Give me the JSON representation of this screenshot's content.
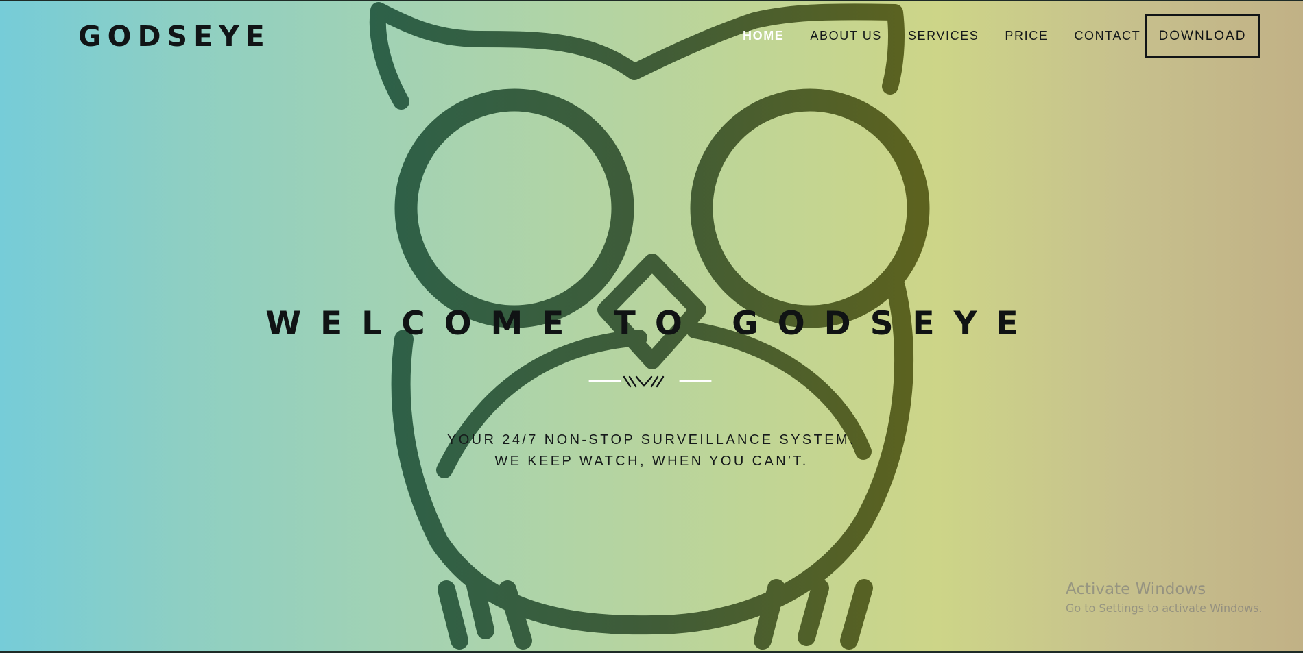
{
  "brand": {
    "logo": "GODSEYE"
  },
  "nav": {
    "items": [
      {
        "label": "HOME",
        "active": true
      },
      {
        "label": "ABOUT US",
        "active": false
      },
      {
        "label": "SERVICES",
        "active": false
      },
      {
        "label": "PRICE",
        "active": false
      },
      {
        "label": "CONTACT",
        "active": false
      }
    ],
    "download_label": "DOWNLOAD"
  },
  "hero": {
    "title": "WELCOME TO GODSEYE",
    "tagline_line1": "YOUR 24/7 NON-STOP SURVEILLANCE SYSTEM.",
    "tagline_line2": "WE KEEP WATCH, WHEN YOU CAN'T."
  },
  "os_overlay": {
    "title": "Activate Windows",
    "subtitle": "Go to Settings to activate Windows."
  },
  "colors": {
    "owl_stroke_left": "#2d6149",
    "owl_stroke_right": "#5c621f",
    "gradient_left": "#76ccd8",
    "gradient_right": "#c1b186",
    "text_dark": "#111416",
    "nav_active": "#ffffff"
  }
}
